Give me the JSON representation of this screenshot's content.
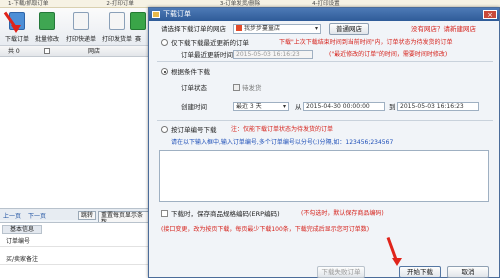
{
  "steps": [
    "1-下载/抓取订单",
    "2-打印订单",
    "3-订单发货/删除",
    "4-打印设置"
  ],
  "toolbar": {
    "download": "下载订单",
    "batch_edit": "批量修改",
    "print_express": "打印快递单",
    "print_invoice": "打印发货单",
    "more": "赛",
    "shop": "网店"
  },
  "table": {
    "col1": "共 0",
    "col2": "网店"
  },
  "pager": {
    "prev": "上一页",
    "next": "下一页",
    "btn1": "跳转",
    "btn2": "重置每页显示条数"
  },
  "basic": {
    "tab": "基本信息",
    "order_no": "订单编号",
    "buyer_note": "买/卖家备注"
  },
  "dialog": {
    "title": "下载订单",
    "shop_label": "请选择下载订单的网店",
    "shop_value": "我步步蔓童店",
    "shop_btn": "普通网店",
    "notice": "没有网店？请新建网店",
    "opt1": "仅下载下载最近更新的订单",
    "opt1_note": "下载\"上次下载结束时间到当前时间\"内，订单状态为待发货的订单",
    "last_time_label": "订单最近更新时间",
    "last_time_value": "2015-05-03 16:16:23",
    "last_time_note": "(\"最近修改的订单\"的时间，需要时间时修改)",
    "opt2": "根据条件下载",
    "status_label": "订单状态",
    "status_value": "待发货",
    "create_label": "创建时间",
    "range_value": "最近 3 天",
    "from_label": "从",
    "from_value": "2015-04-30 00:00:00",
    "to_label": "到",
    "to_value": "2015-05-03 16:16:23",
    "opt3": "按订单编号下载",
    "opt3_note": "注：仅能下载订单状态为待发货的订单",
    "opt3_hint": "请在以下输入框中,输入订单编号,多个订单编号以分号(;)分隔,如：123456;234567",
    "check_label": "下载时，保存商品规格编码(ERP编码)",
    "check_note": "(不勾选时，默认保存商品编码)",
    "footer_note": "(接口变更，改为按页下载，每页最少下载100条，下载完成后显示您可订单数)",
    "btn_fail": "下载失败订单",
    "btn_start": "开始下载",
    "btn_cancel": "取消"
  }
}
